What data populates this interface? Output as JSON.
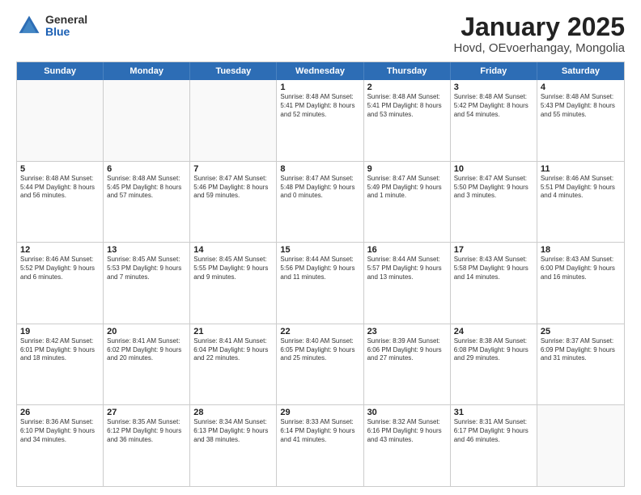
{
  "logo": {
    "general": "General",
    "blue": "Blue"
  },
  "title": {
    "month": "January 2025",
    "location": "Hovd, OEvoerhangay, Mongolia"
  },
  "header_days": [
    "Sunday",
    "Monday",
    "Tuesday",
    "Wednesday",
    "Thursday",
    "Friday",
    "Saturday"
  ],
  "weeks": [
    [
      {
        "day": "",
        "info": ""
      },
      {
        "day": "",
        "info": ""
      },
      {
        "day": "",
        "info": ""
      },
      {
        "day": "1",
        "info": "Sunrise: 8:48 AM\nSunset: 5:41 PM\nDaylight: 8 hours\nand 52 minutes."
      },
      {
        "day": "2",
        "info": "Sunrise: 8:48 AM\nSunset: 5:41 PM\nDaylight: 8 hours\nand 53 minutes."
      },
      {
        "day": "3",
        "info": "Sunrise: 8:48 AM\nSunset: 5:42 PM\nDaylight: 8 hours\nand 54 minutes."
      },
      {
        "day": "4",
        "info": "Sunrise: 8:48 AM\nSunset: 5:43 PM\nDaylight: 8 hours\nand 55 minutes."
      }
    ],
    [
      {
        "day": "5",
        "info": "Sunrise: 8:48 AM\nSunset: 5:44 PM\nDaylight: 8 hours\nand 56 minutes."
      },
      {
        "day": "6",
        "info": "Sunrise: 8:48 AM\nSunset: 5:45 PM\nDaylight: 8 hours\nand 57 minutes."
      },
      {
        "day": "7",
        "info": "Sunrise: 8:47 AM\nSunset: 5:46 PM\nDaylight: 8 hours\nand 59 minutes."
      },
      {
        "day": "8",
        "info": "Sunrise: 8:47 AM\nSunset: 5:48 PM\nDaylight: 9 hours\nand 0 minutes."
      },
      {
        "day": "9",
        "info": "Sunrise: 8:47 AM\nSunset: 5:49 PM\nDaylight: 9 hours\nand 1 minute."
      },
      {
        "day": "10",
        "info": "Sunrise: 8:47 AM\nSunset: 5:50 PM\nDaylight: 9 hours\nand 3 minutes."
      },
      {
        "day": "11",
        "info": "Sunrise: 8:46 AM\nSunset: 5:51 PM\nDaylight: 9 hours\nand 4 minutes."
      }
    ],
    [
      {
        "day": "12",
        "info": "Sunrise: 8:46 AM\nSunset: 5:52 PM\nDaylight: 9 hours\nand 6 minutes."
      },
      {
        "day": "13",
        "info": "Sunrise: 8:45 AM\nSunset: 5:53 PM\nDaylight: 9 hours\nand 7 minutes."
      },
      {
        "day": "14",
        "info": "Sunrise: 8:45 AM\nSunset: 5:55 PM\nDaylight: 9 hours\nand 9 minutes."
      },
      {
        "day": "15",
        "info": "Sunrise: 8:44 AM\nSunset: 5:56 PM\nDaylight: 9 hours\nand 11 minutes."
      },
      {
        "day": "16",
        "info": "Sunrise: 8:44 AM\nSunset: 5:57 PM\nDaylight: 9 hours\nand 13 minutes."
      },
      {
        "day": "17",
        "info": "Sunrise: 8:43 AM\nSunset: 5:58 PM\nDaylight: 9 hours\nand 14 minutes."
      },
      {
        "day": "18",
        "info": "Sunrise: 8:43 AM\nSunset: 6:00 PM\nDaylight: 9 hours\nand 16 minutes."
      }
    ],
    [
      {
        "day": "19",
        "info": "Sunrise: 8:42 AM\nSunset: 6:01 PM\nDaylight: 9 hours\nand 18 minutes."
      },
      {
        "day": "20",
        "info": "Sunrise: 8:41 AM\nSunset: 6:02 PM\nDaylight: 9 hours\nand 20 minutes."
      },
      {
        "day": "21",
        "info": "Sunrise: 8:41 AM\nSunset: 6:04 PM\nDaylight: 9 hours\nand 22 minutes."
      },
      {
        "day": "22",
        "info": "Sunrise: 8:40 AM\nSunset: 6:05 PM\nDaylight: 9 hours\nand 25 minutes."
      },
      {
        "day": "23",
        "info": "Sunrise: 8:39 AM\nSunset: 6:06 PM\nDaylight: 9 hours\nand 27 minutes."
      },
      {
        "day": "24",
        "info": "Sunrise: 8:38 AM\nSunset: 6:08 PM\nDaylight: 9 hours\nand 29 minutes."
      },
      {
        "day": "25",
        "info": "Sunrise: 8:37 AM\nSunset: 6:09 PM\nDaylight: 9 hours\nand 31 minutes."
      }
    ],
    [
      {
        "day": "26",
        "info": "Sunrise: 8:36 AM\nSunset: 6:10 PM\nDaylight: 9 hours\nand 34 minutes."
      },
      {
        "day": "27",
        "info": "Sunrise: 8:35 AM\nSunset: 6:12 PM\nDaylight: 9 hours\nand 36 minutes."
      },
      {
        "day": "28",
        "info": "Sunrise: 8:34 AM\nSunset: 6:13 PM\nDaylight: 9 hours\nand 38 minutes."
      },
      {
        "day": "29",
        "info": "Sunrise: 8:33 AM\nSunset: 6:14 PM\nDaylight: 9 hours\nand 41 minutes."
      },
      {
        "day": "30",
        "info": "Sunrise: 8:32 AM\nSunset: 6:16 PM\nDaylight: 9 hours\nand 43 minutes."
      },
      {
        "day": "31",
        "info": "Sunrise: 8:31 AM\nSunset: 6:17 PM\nDaylight: 9 hours\nand 46 minutes."
      },
      {
        "day": "",
        "info": ""
      }
    ]
  ]
}
